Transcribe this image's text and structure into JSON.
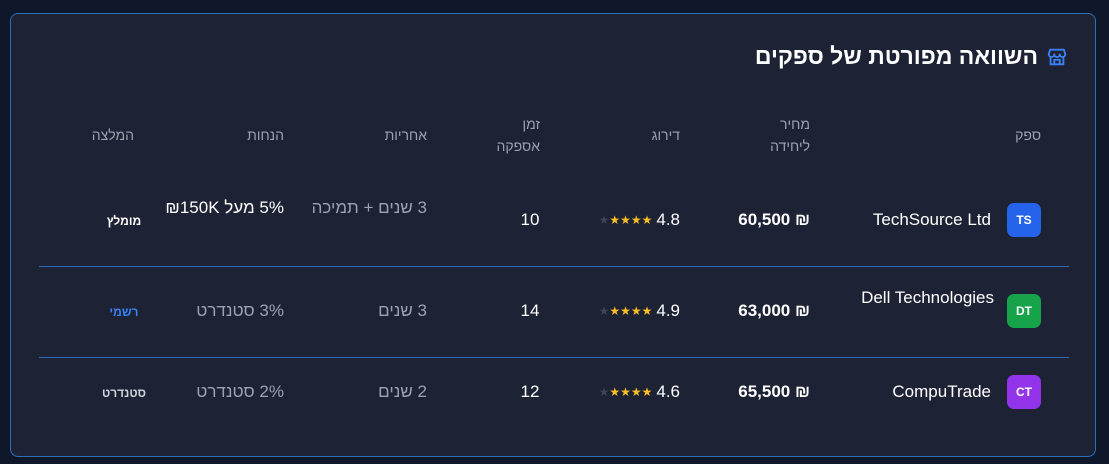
{
  "header": {
    "title": "השוואה מפורטת של ספקים",
    "icon": "store-icon"
  },
  "columns": {
    "supplier": "ספק",
    "unit_price": "מחיר ליחידה",
    "rating": "דירוג",
    "lead_time": "זמן אספקה",
    "warranty": "אחריות",
    "discounts": "הנחות",
    "recommendation": "המלצה"
  },
  "colors": {
    "accent": "#3b82f6",
    "star": "#fbbf24",
    "border": "#2f6fb8",
    "card_bg": "#1e2235"
  },
  "rows": [
    {
      "initials": "TS",
      "avatar_color": "#2563eb",
      "supplier": "TechSource Ltd",
      "price": "₪ 60,500",
      "stars": "★★★★",
      "rating": "4.8",
      "lead_time": "10",
      "warranty": "3 שנים + תמיכה",
      "discount": "5% מעל 150K₪",
      "recommendation": "מומלץ",
      "recommendation_color": "#ffffff"
    },
    {
      "initials": "DT",
      "avatar_color": "#16a34a",
      "supplier": "Dell Technologies",
      "price": "₪ 63,000",
      "stars": "★★★★",
      "rating": "4.9",
      "lead_time": "14",
      "warranty": "3 שנים",
      "discount": "3% סטנדרט",
      "recommendation": "רשמי",
      "recommendation_color": "#3b82f6"
    },
    {
      "initials": "CT",
      "avatar_color": "#9333ea",
      "supplier": "CompuTrade",
      "price": "₪ 65,500",
      "stars": "★★★★",
      "rating": "4.6",
      "lead_time": "12",
      "warranty": "2 שנים",
      "discount": "2% סטנדרט",
      "recommendation": "סטנדרט",
      "recommendation_color": "#d1d5db"
    }
  ]
}
